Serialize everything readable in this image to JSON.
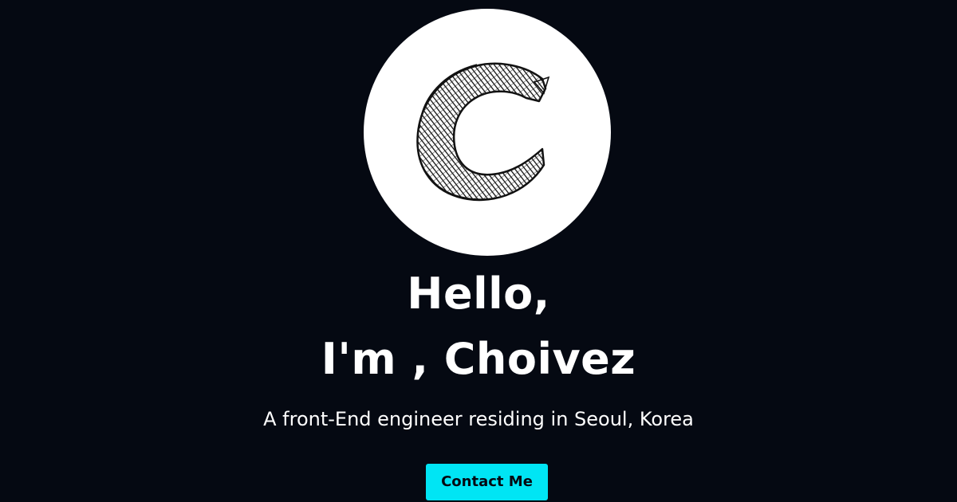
{
  "profile": {
    "avatar_letter": "C"
  },
  "hero": {
    "greeting_line_1": "Hello,",
    "greeting_line_2": "I'm , Choivez",
    "tagline": "A front-End engineer residing in Seoul, Korea"
  },
  "actions": {
    "contact_label": "Contact Me"
  },
  "colors": {
    "background": "#050912",
    "text": "#ffffff",
    "button": "#00e5f4",
    "button_text": "#050912",
    "avatar_background": "#ffffff"
  }
}
